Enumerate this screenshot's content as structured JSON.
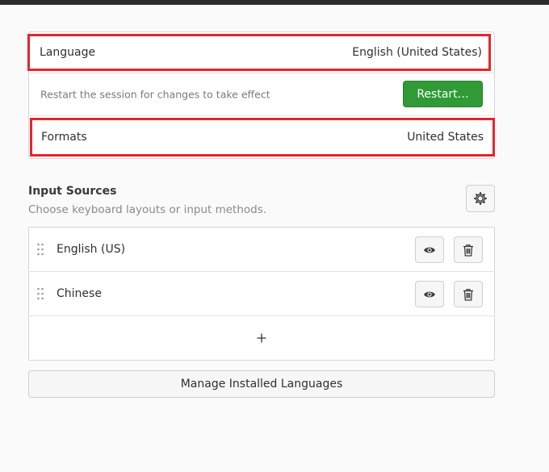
{
  "language_card": {
    "language_label": "Language",
    "language_value": "English (United States)",
    "restart_notice": "Restart the session for changes to take effect",
    "restart_button": "Restart…",
    "formats_label": "Formats",
    "formats_value": "United States"
  },
  "input_sources": {
    "title": "Input Sources",
    "subtitle": "Choose keyboard layouts or input methods.",
    "options_icon": "gear-icon",
    "items": [
      {
        "label": "English (US)",
        "preview_icon": "eye-icon",
        "remove_icon": "trash-icon"
      },
      {
        "label": "Chinese",
        "preview_icon": "eye-icon",
        "remove_icon": "trash-icon"
      }
    ],
    "add_icon": "plus-icon"
  },
  "manage_languages_button": "Manage Installed Languages",
  "colors": {
    "highlight": "#e3262c",
    "restart_green": "#2f9a36",
    "background": "#fafafa"
  }
}
